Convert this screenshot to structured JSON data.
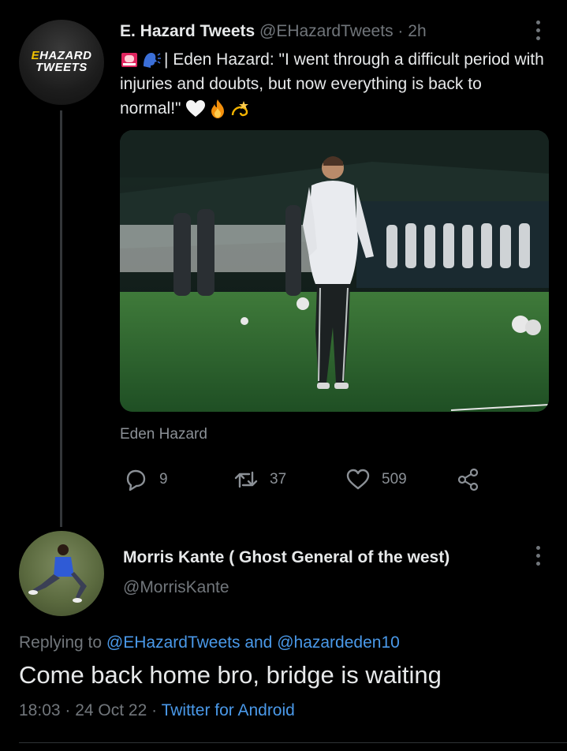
{
  "tweet": {
    "avatar_logo_line1": "EHAZARD",
    "avatar_logo_line2": "TWEETS",
    "display_name": "E. Hazard Tweets",
    "handle": "@EHazardTweets",
    "separator": "·",
    "time": "2h",
    "text": "| Eden Hazard: \"I went through a difficult period with injuries and doubts, but now everything is back to normal!\"",
    "lead_emojis": [
      "police-light-icon",
      "speaking-head-icon"
    ],
    "trail_emojis": [
      "white-heart-icon",
      "fire-icon",
      "dizzy-icon"
    ],
    "media_caption": "Eden Hazard",
    "actions": {
      "replies": "9",
      "retweets": "37",
      "likes": "509"
    }
  },
  "reply": {
    "display_name": "Morris Kante ( Ghost General of the west)",
    "handle": "@MorrisKante",
    "replying_prefix": "Replying to",
    "replying_user1": "@EHazardTweets",
    "replying_and": "and",
    "replying_user2": "@hazardeden10",
    "text": "Come back home bro, bridge is waiting",
    "time": "18:03",
    "date": "24 Oct 22",
    "source": "Twitter for Android"
  },
  "colors": {
    "background": "#000000",
    "link": "#4a99e9",
    "muted": "#71767b",
    "text": "#e7e9ea"
  }
}
